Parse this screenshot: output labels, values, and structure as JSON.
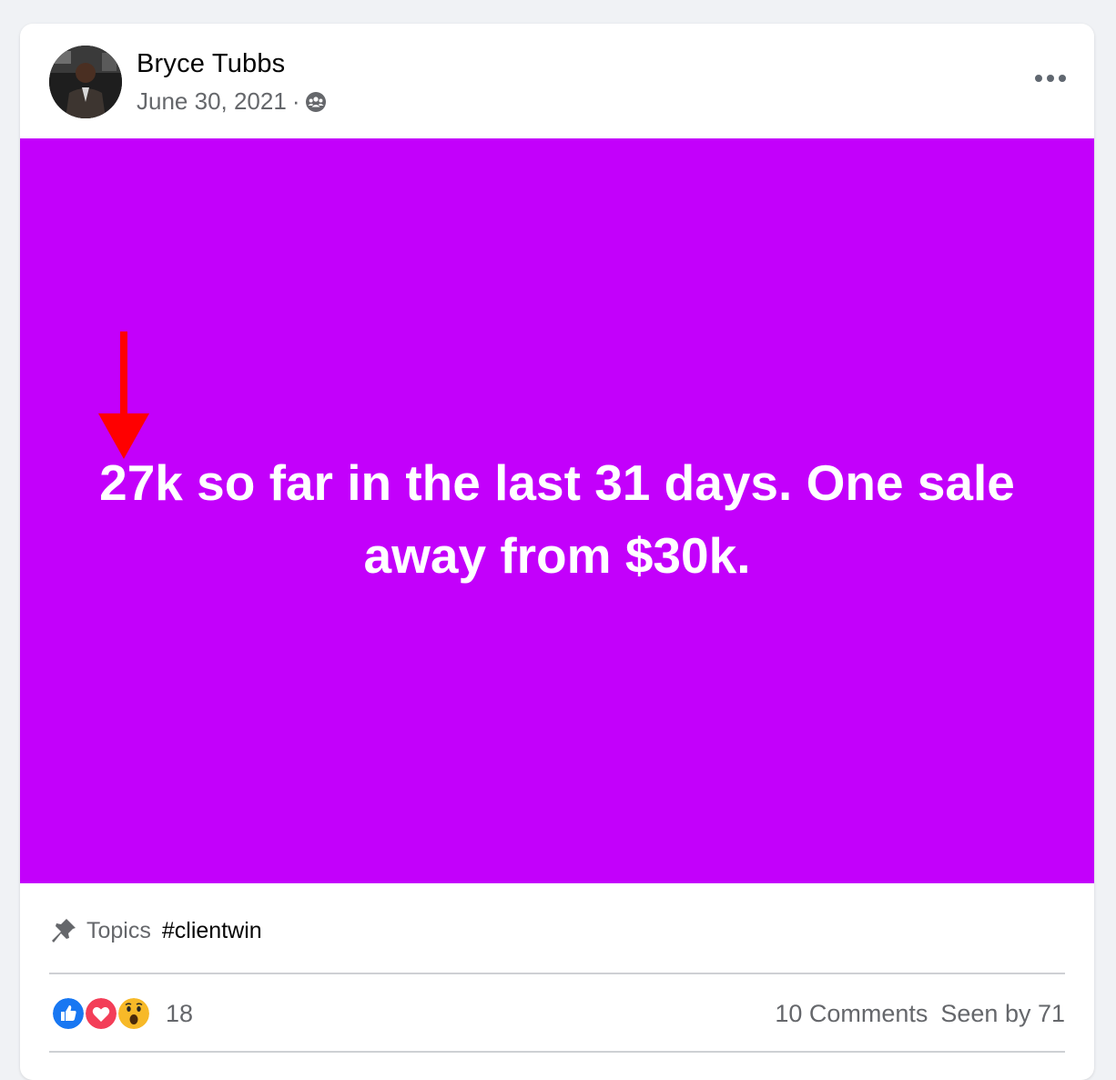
{
  "post": {
    "author": "Bryce Tubbs",
    "date": "June 30, 2021",
    "separator": "·",
    "audience_icon": "group-audience-icon",
    "more_icon": "more-options-icon",
    "text": "27k so far in the last 31 days. One sale away from $30k.",
    "background_color": "#c300fb",
    "annotation": {
      "type": "arrow",
      "direction": "down",
      "color": "#ff0000"
    }
  },
  "topics": {
    "icon": "pin-icon",
    "label": "Topics",
    "tag": "#clientwin"
  },
  "footer": {
    "reactions": [
      "like",
      "love",
      "wow"
    ],
    "reaction_count": "18",
    "comments": "10 Comments",
    "seen_by": "Seen by 71"
  }
}
